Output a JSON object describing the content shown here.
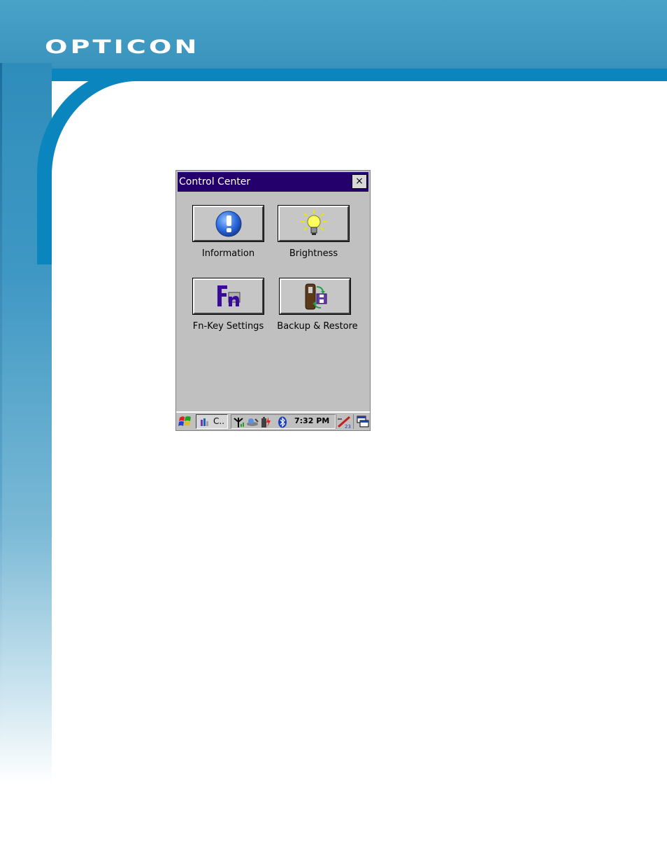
{
  "brand": {
    "logo_text": "OPTICON"
  },
  "window": {
    "title": "Control Center",
    "close_label": "×"
  },
  "tiles": [
    {
      "label": "Information",
      "icon": "information-icon"
    },
    {
      "label": "Brightness",
      "icon": "brightness-icon"
    },
    {
      "label": "Fn-Key Settings",
      "icon": "fn-key-icon"
    },
    {
      "label": "Backup & Restore",
      "icon": "backup-restore-icon"
    }
  ],
  "taskbar": {
    "task_label": "C..",
    "clock": "7:32 PM",
    "tray_icons": [
      "signal-icon",
      "network-icon",
      "battery-icon",
      "bluetooth-icon"
    ],
    "right_icons": [
      "input-panel-icon",
      "desktop-icon"
    ]
  },
  "colors": {
    "banner": "#3b94bd",
    "titlebar": "#24006c",
    "window_bg": "#c0c0c0"
  }
}
